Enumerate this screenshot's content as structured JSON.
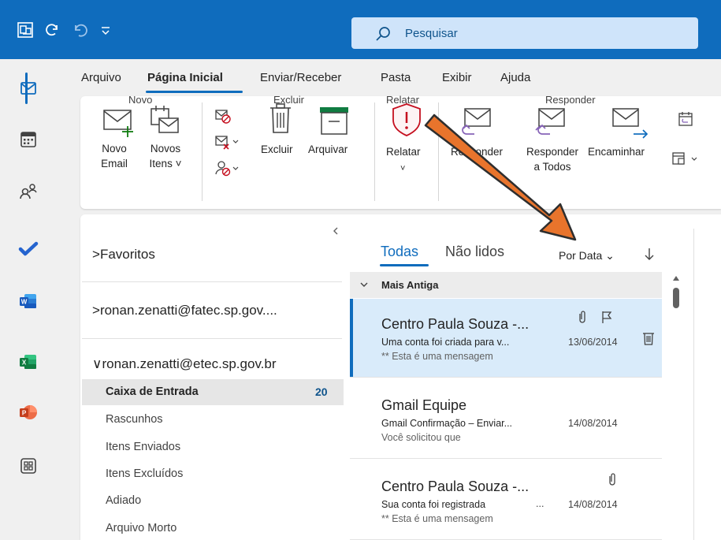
{
  "titlebar": {
    "search_placeholder": "Pesquisar"
  },
  "ribbon_tabs": [
    "Arquivo",
    "Página Inicial",
    "Enviar/Receber",
    "Pasta",
    "Exibir",
    "Ajuda"
  ],
  "ribbon": {
    "new_email_l1": "Novo",
    "new_email_l2": "Email",
    "new_items_l1": "Novos",
    "new_items_l2": "Itens ˅",
    "group_new": "Novo",
    "delete": "Excluir",
    "archive": "Arquivar",
    "group_delete": "Excluir",
    "report": "Relatar",
    "group_report": "Relatar",
    "reply": "Responder",
    "reply_all_l1": "Responder",
    "reply_all_l2": "a Todos",
    "forward": "Encaminhar",
    "group_respond": "Responder"
  },
  "folderpane": {
    "favorites": "Favoritos",
    "account1": "ronan.zenatti@fatec.sp.gov....",
    "account2": "ronan.zenatti@etec.sp.gov.br",
    "folders": [
      {
        "name": "Caixa de Entrada",
        "count": "20"
      },
      {
        "name": "Rascunhos"
      },
      {
        "name": "Itens Enviados"
      },
      {
        "name": "Itens Excluídos"
      },
      {
        "name": "Adiado"
      },
      {
        "name": "Arquivo Morto"
      }
    ]
  },
  "msglist": {
    "tab_all": "Todas",
    "tab_unread": "Não lidos",
    "sort": "Por Data",
    "group": "Mais Antiga",
    "messages": [
      {
        "from": "Centro Paula Souza -...",
        "subject": "Uma conta foi criada para v...",
        "date": "13/06/2014",
        "preview": "** Esta é uma mensagem"
      },
      {
        "from": "Gmail Equipe",
        "subject": "Gmail Confirmação – Enviar...",
        "date": "14/08/2014",
        "preview": "Você solicitou que"
      },
      {
        "from": "Centro Paula Souza -...",
        "subject": "Sua conta foi registrada",
        "date": "14/08/2014",
        "preview": "** Esta é uma mensagem"
      }
    ]
  },
  "colors": {
    "brand": "#0f6cbd",
    "annotation_arrow": "#e8742c"
  }
}
